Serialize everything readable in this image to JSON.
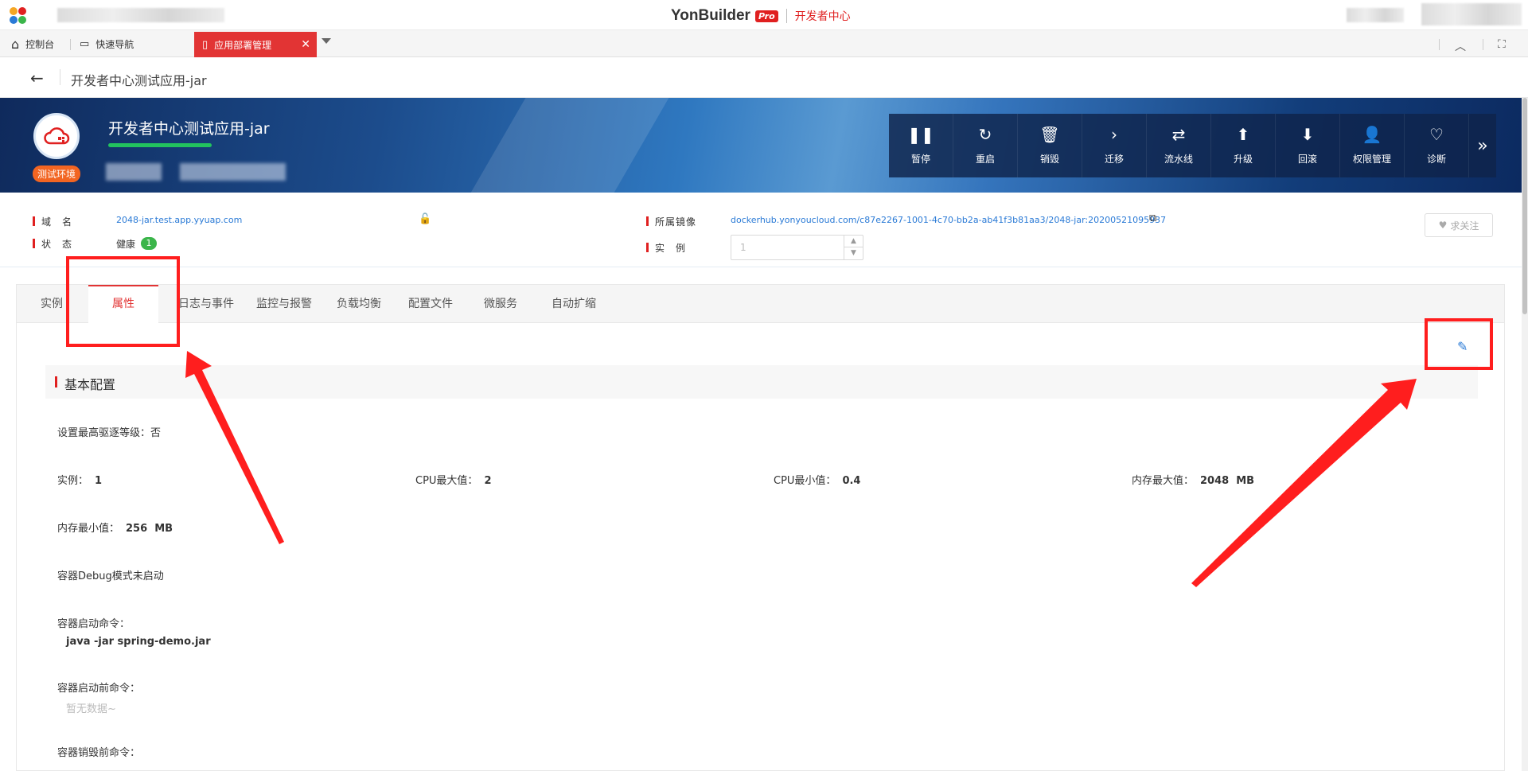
{
  "topbar": {
    "brand_name": "YonBuilder",
    "brand_pro": "Pro",
    "brand_sub": "开发者中心"
  },
  "tabbar": {
    "console": "控制台",
    "quick_nav": "快速导航",
    "active_tab": "应用部署管理"
  },
  "breadcrumb": {
    "title": "开发者中心测试应用-jar"
  },
  "banner": {
    "app_name": "开发者中心测试应用-jar",
    "env_badge": "测试环境",
    "actions": [
      {
        "label": "暂停",
        "icon": "pause-icon"
      },
      {
        "label": "重启",
        "icon": "restart-icon"
      },
      {
        "label": "销毁",
        "icon": "trash-icon"
      },
      {
        "label": "迁移",
        "icon": "chevron-right-icon"
      },
      {
        "label": "流水线",
        "icon": "pipeline-icon"
      },
      {
        "label": "升级",
        "icon": "upgrade-icon"
      },
      {
        "label": "回滚",
        "icon": "rollback-icon"
      },
      {
        "label": "权限管理",
        "icon": "permission-icon"
      },
      {
        "label": "诊断",
        "icon": "diagnose-icon"
      }
    ]
  },
  "info": {
    "domain_label": "域　名",
    "domain_value": "2048-jar.test.app.yyuap.com",
    "status_label": "状　态",
    "status_value": "健康",
    "status_count": "1",
    "image_label": "所属镜像",
    "image_value": "dockerhub.yonyoucloud.com/c87e2267-1001-4c70-bb2a-ab41f3b81aa3/2048-jar:20200521095937",
    "instance_label": "实　例",
    "instance_value": "1",
    "follow_label": "求关注"
  },
  "tabs": [
    "实例",
    "属性",
    "日志与事件",
    "监控与报警",
    "负载均衡",
    "配置文件",
    "微服务",
    "自动扩缩"
  ],
  "active_tab_index": 1,
  "basic": {
    "title": "基本配置",
    "max_evict_label": "设置最高驱逐等级：",
    "max_evict_value": "否",
    "instances_label": "实例：",
    "instances_value": "1",
    "cpu_max_label": "CPU最大值：",
    "cpu_max_value": "2",
    "cpu_min_label": "CPU最小值：",
    "cpu_min_value": "0.4",
    "mem_max_label": "内存最大值：",
    "mem_max_value": "2048  MB",
    "mem_min_label": "内存最小值：",
    "mem_min_value": "256  MB",
    "debug_text": "容器Debug模式未启动",
    "start_cmd_label": "容器启动命令：",
    "start_cmd_value": "java -jar spring-demo.jar",
    "pre_start_label": "容器启动前命令：",
    "pre_start_value": "暂无数据~",
    "pre_destroy_label": "容器销毁前命令："
  },
  "colors": {
    "accent": "#e23434",
    "link": "#2a7ad6",
    "annotation": "#ff1e1e",
    "env_badge": "#f26522"
  }
}
